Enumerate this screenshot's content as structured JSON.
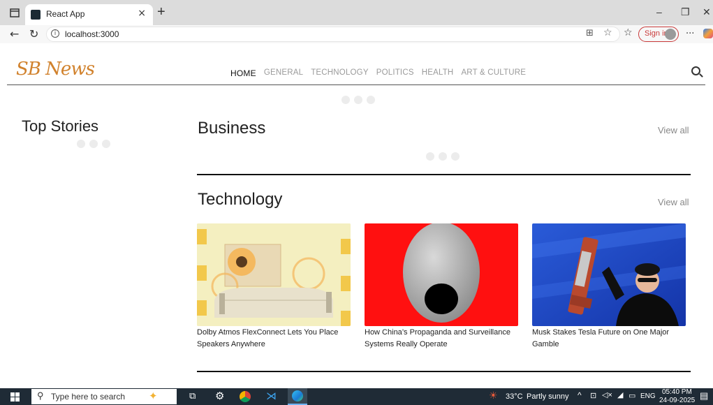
{
  "browser": {
    "tab_title": "React App",
    "tab_close": "×",
    "new_tab": "+",
    "url": "localhost:3000",
    "sign_in": "Sign in",
    "more": "···",
    "window_controls": [
      "–",
      "❐",
      "✕"
    ]
  },
  "site": {
    "logo": "SB News",
    "nav": [
      "HOME",
      "GENERAL",
      "TECHNOLOGY",
      "POLITICS",
      "HEALTH",
      "ART & CULTURE"
    ],
    "active_nav": "HOME"
  },
  "sidebar": {
    "title": "Top Stories"
  },
  "sections": {
    "business": {
      "title": "Business",
      "view_all": "View all"
    },
    "technology": {
      "title": "Technology",
      "view_all": "View all",
      "articles": [
        {
          "caption": "Dolby Atmos FlexConnect Lets You Place Speakers Anywhere"
        },
        {
          "caption": "How China’s Propaganda and Surveillance Systems Really Operate"
        },
        {
          "caption": "Musk Stakes Tesla Future on One Major Gamble"
        }
      ]
    }
  },
  "taskbar": {
    "search_placeholder": "Type here to search",
    "temperature": "33°C",
    "weather": "Partly sunny",
    "language": "ENG",
    "time": "05:40 PM",
    "date": "24-09-2025"
  },
  "colors": {
    "logo": "#d1822d",
    "signin": "#c93a3a",
    "taskbar": "#1f2b36"
  }
}
